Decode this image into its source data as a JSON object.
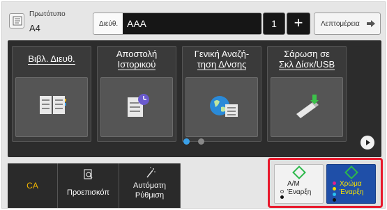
{
  "original": {
    "label": "Πρωτότυπο",
    "value": "A4"
  },
  "address": {
    "label": "Διεύθ.",
    "value": "AAA"
  },
  "copies": {
    "value": "1",
    "plus_label": "+"
  },
  "details": {
    "label": "Λεπτομέρεια"
  },
  "tiles": [
    {
      "line1": "Βιβλ. Διευθ.",
      "line2": "",
      "icon": "address-book-icon"
    },
    {
      "line1": "Αποστολή",
      "line2": "Ιστορικού",
      "icon": "send-history-icon"
    },
    {
      "line1": "Γενική Αναζή-",
      "line2": "τηση Δ/νσης",
      "icon": "global-search-icon"
    },
    {
      "line1": "Σάρωση σε",
      "line2": "Σκλ Δίσκ/USB",
      "icon": "usb-scan-icon"
    }
  ],
  "pagination": {
    "active_color": "#3aa0e8",
    "inactive_color": "#888888"
  },
  "bottom": {
    "ca": "CA",
    "preview": "Προεπισκόπ",
    "auto_line1": "Αυτόματη",
    "auto_line2": "Ρύθμιση"
  },
  "start": {
    "mono_line1": "Α/Μ",
    "mono_line2": "Έναρξη",
    "color_line1": "Χρώμα",
    "color_line2": "Έναρξη",
    "accent": "#e8192c",
    "start_green": "#2db84b",
    "color_button_bg": "#1f4fa8"
  }
}
